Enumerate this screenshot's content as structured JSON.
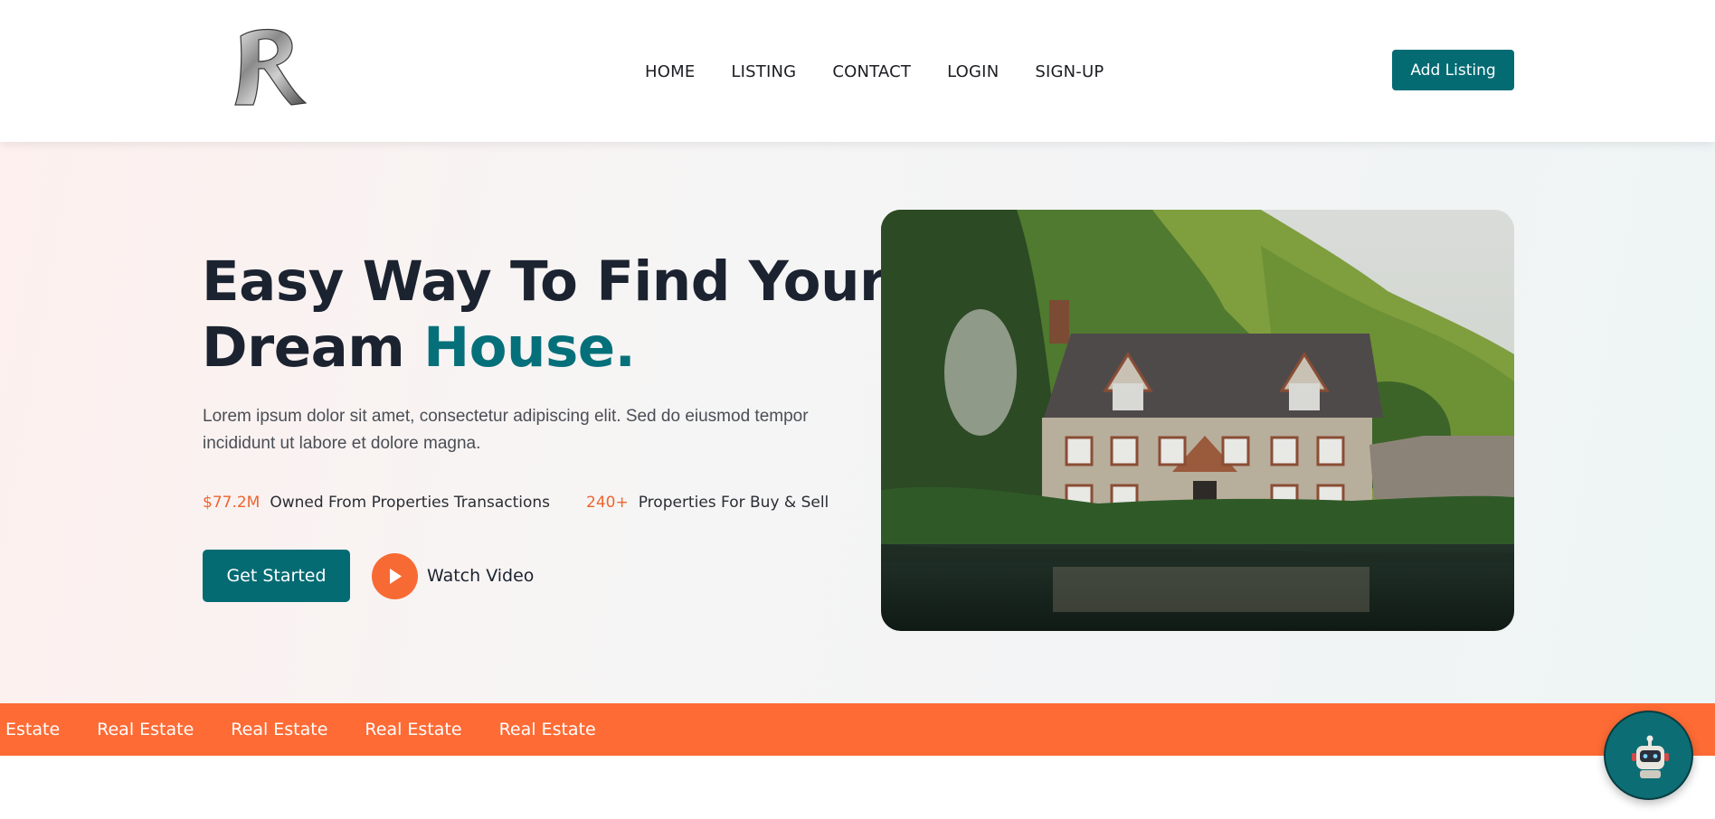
{
  "header": {
    "logo_icon": "chrome-letter-r-logo",
    "nav": [
      {
        "label": "HOME"
      },
      {
        "label": "LISTING"
      },
      {
        "label": "CONTACT"
      },
      {
        "label": "LOGIN"
      },
      {
        "label": "SIGN-UP"
      }
    ],
    "add_listing_label": "Add Listing"
  },
  "hero": {
    "headline_part1": "Easy Way To Find Your",
    "headline_part2_plain": "Dream ",
    "headline_part2_accent": "House.",
    "description": "Lorem ipsum dolor sit amet, consectetur adipiscing elit. Sed do eiusmod tempor incididunt ut labore et dolore magna.",
    "stats": [
      {
        "value": "$77.2M",
        "label": "Owned From Properties Transactions"
      },
      {
        "value": "240+",
        "label": "Properties For Buy & Sell"
      }
    ],
    "get_started_label": "Get Started",
    "watch_video_label": "Watch Video",
    "play_icon": "play-icon",
    "image_subject": "house-by-lake-photo"
  },
  "ticker": {
    "items": [
      "Real Estate",
      "Real Estate",
      "Real Estate",
      "Real Estate",
      "Real Estate"
    ]
  },
  "chatbot": {
    "icon": "robot-icon"
  },
  "colors": {
    "primary": "#046b73",
    "accent_orange": "#fe6b35",
    "heading": "#1c2330",
    "stat_highlight": "#ef6430"
  }
}
